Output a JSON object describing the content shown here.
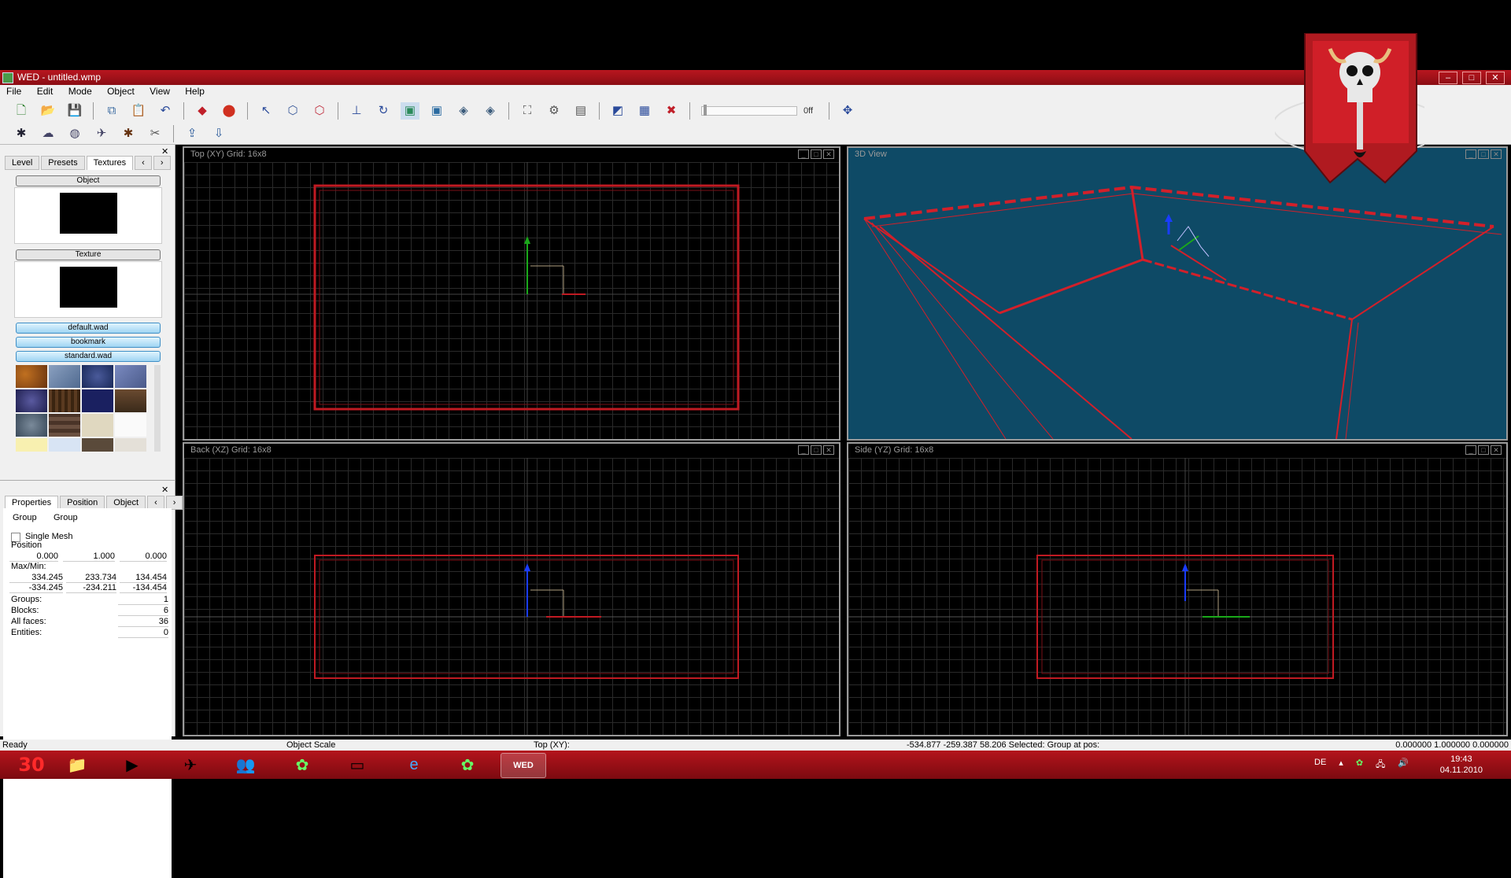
{
  "window": {
    "title": "WED - untitled.wmp",
    "controls": [
      "–",
      "□",
      "✕"
    ]
  },
  "menu": [
    "File",
    "Edit",
    "Mode",
    "Object",
    "View",
    "Help"
  ],
  "toolbar": {
    "slider_value": "0ff"
  },
  "left_panel": {
    "top_tabs": [
      "Level",
      "Presets",
      "Textures"
    ],
    "object_label": "Object",
    "texture_label": "Texture",
    "wad_buttons": [
      "default.wad",
      "bookmark",
      "standard.wad"
    ],
    "bottom_tabs": [
      "Properties",
      "Position",
      "Object"
    ],
    "group_row": {
      "label": "Group",
      "value": "Group"
    },
    "single_mesh_label": "Single Mesh",
    "position_label": "Position",
    "position_values": [
      "0.000",
      "1.000",
      "0.000"
    ],
    "maxmin_label": "Max/Min:",
    "max_values": [
      "334.245",
      "233.734",
      "134.454"
    ],
    "min_values": [
      "-334.245",
      "-234.211",
      "-134.454"
    ],
    "stats": [
      {
        "label": "Groups:",
        "value": "1"
      },
      {
        "label": "Blocks:",
        "value": "6"
      },
      {
        "label": "All faces:",
        "value": "36"
      },
      {
        "label": "Entities:",
        "value": "0"
      }
    ]
  },
  "viewports": {
    "top": "Top (XY) Grid: 16x8",
    "view3d": "3D View",
    "back": "Back (XZ) Grid: 16x8",
    "side": "Side (YZ) Grid: 16x8"
  },
  "statusbar": {
    "ready": "Ready",
    "mode": "Object Scale",
    "view": "Top (XY):",
    "coords": "-534.877 -259.387 58.206  Selected: Group at pos:",
    "scale": "0.000000 1.000000 0.000000"
  },
  "taskbar": {
    "start_label": "30",
    "lang": "DE",
    "time": "19:43",
    "date": "04.11.2010",
    "active_app": "WED"
  },
  "colors": {
    "accent_red": "#b8161f",
    "wire_red": "#d2202a",
    "viewport3d_bg": "#0e4a66"
  }
}
